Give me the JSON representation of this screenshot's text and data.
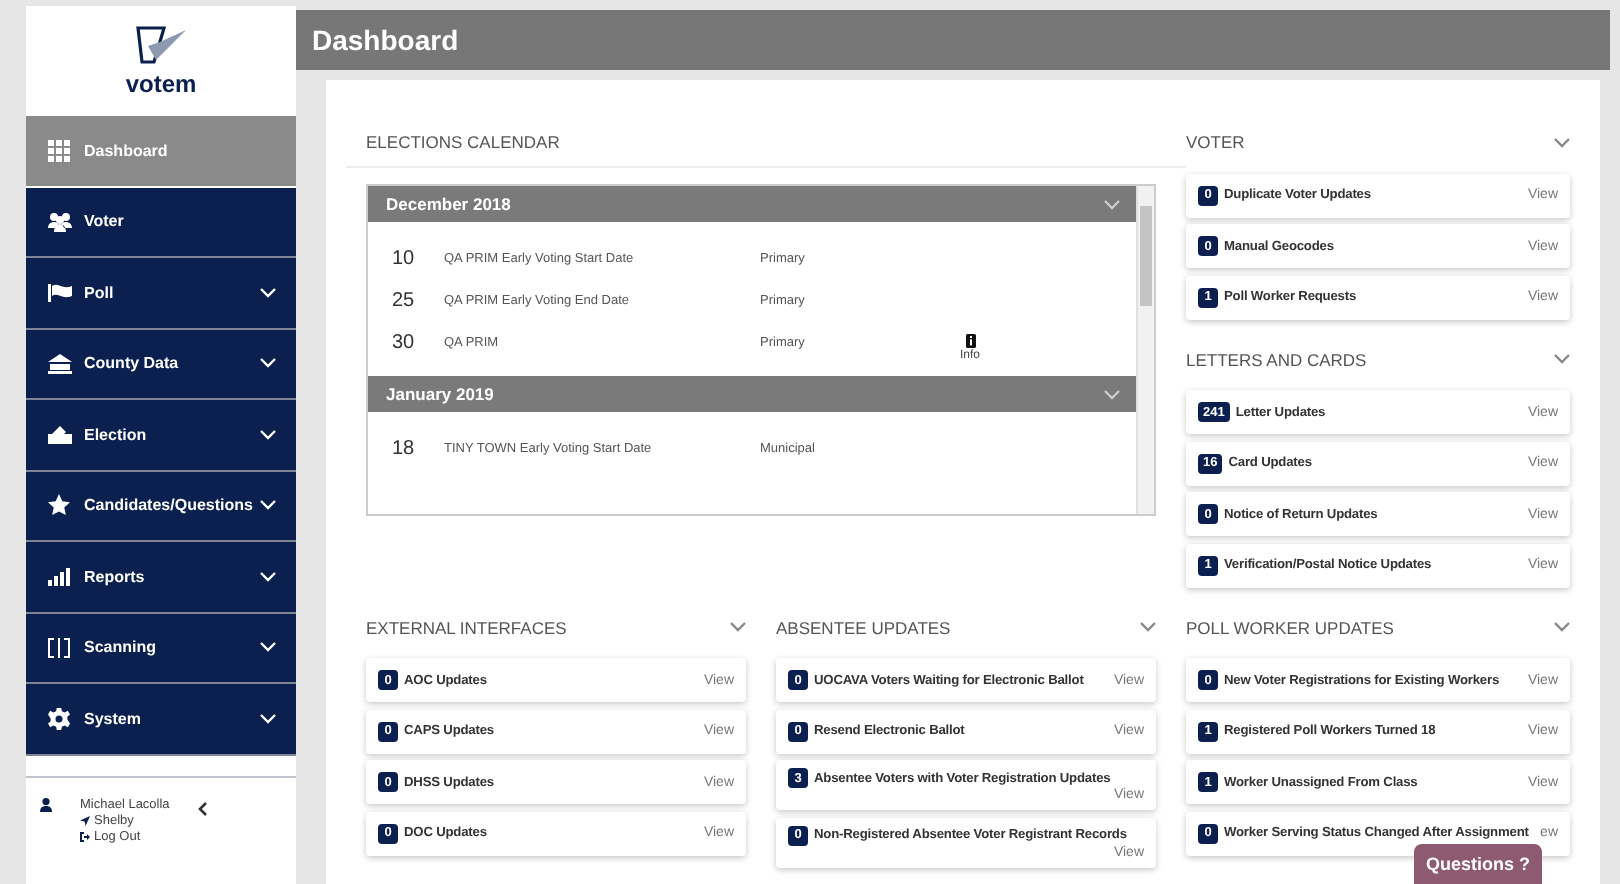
{
  "sidebar": {
    "logo": "votem",
    "items": [
      {
        "label": "Dashboard",
        "selected": true,
        "expandable": false
      },
      {
        "label": "Voter",
        "selected": false,
        "expandable": false
      },
      {
        "label": "Poll",
        "selected": false,
        "expandable": true
      },
      {
        "label": "County Data",
        "selected": false,
        "expandable": true
      },
      {
        "label": "Election",
        "selected": false,
        "expandable": true
      },
      {
        "label": "Candidates/Questions",
        "selected": false,
        "expandable": true
      },
      {
        "label": "Reports",
        "selected": false,
        "expandable": true
      },
      {
        "label": "Scanning",
        "selected": false,
        "expandable": true
      },
      {
        "label": "System",
        "selected": false,
        "expandable": true
      }
    ],
    "user": {
      "name": "Michael Lacolla",
      "location": "Shelby",
      "logout": "Log Out"
    }
  },
  "header": {
    "title": "Dashboard"
  },
  "calendar": {
    "title": "ELECTIONS CALENDAR",
    "months": [
      {
        "label": "December 2018",
        "events": [
          {
            "day": "10",
            "name": "QA PRIM Early Voting Start Date",
            "type": "Primary"
          },
          {
            "day": "25",
            "name": "QA PRIM Early Voting End Date",
            "type": "Primary"
          },
          {
            "day": "30",
            "name": "QA PRIM",
            "type": "Primary",
            "info": "Info"
          }
        ]
      },
      {
        "label": "January 2019",
        "events": [
          {
            "day": "18",
            "name": "TINY TOWN Early Voting Start Date",
            "type": "Municipal"
          }
        ]
      }
    ]
  },
  "panels": [
    {
      "title": "VOTER",
      "items": [
        {
          "count": "0",
          "label": "Duplicate Voter Updates",
          "link": "View"
        },
        {
          "count": "0",
          "label": "Manual Geocodes",
          "link": "View"
        },
        {
          "count": "1",
          "label": "Poll Worker Requests",
          "link": "View"
        }
      ]
    },
    {
      "title": "LETTERS AND CARDS",
      "items": [
        {
          "count": "241",
          "label": "Letter Updates",
          "link": "View"
        },
        {
          "count": "16",
          "label": "Card Updates",
          "link": "View"
        },
        {
          "count": "0",
          "label": "Notice of Return Updates",
          "link": "View"
        },
        {
          "count": "1",
          "label": "Verification/Postal Notice Updates",
          "link": "View"
        }
      ]
    },
    {
      "title": "EXTERNAL INTERFACES",
      "items": [
        {
          "count": "0",
          "label": "AOC Updates",
          "link": "View"
        },
        {
          "count": "0",
          "label": "CAPS Updates",
          "link": "View"
        },
        {
          "count": "0",
          "label": "DHSS Updates",
          "link": "View"
        },
        {
          "count": "0",
          "label": "DOC Updates",
          "link": "View"
        }
      ]
    },
    {
      "title": "ABSENTEE UPDATES",
      "items": [
        {
          "count": "0",
          "label": "UOCAVA Voters Waiting for Electronic Ballot",
          "link": "View"
        },
        {
          "count": "0",
          "label": "Resend Electronic Ballot",
          "link": "View"
        },
        {
          "count": "3",
          "label": "Absentee Voters with Voter Registration Updates",
          "link": "View"
        },
        {
          "count": "0",
          "label": "Non-Registered Absentee Voter Registrant Records",
          "link": "View"
        }
      ]
    },
    {
      "title": "POLL WORKER UPDATES",
      "items": [
        {
          "count": "0",
          "label": "New Voter Registrations for Existing Workers",
          "link": "View"
        },
        {
          "count": "1",
          "label": "Registered Poll Workers Turned 18",
          "link": "View"
        },
        {
          "count": "1",
          "label": "Worker Unassigned From Class",
          "link": "View"
        },
        {
          "count": "0",
          "label": "Worker Serving Status Changed After Assignment",
          "link": "ew"
        }
      ]
    }
  ],
  "help_button": "Questions ?"
}
